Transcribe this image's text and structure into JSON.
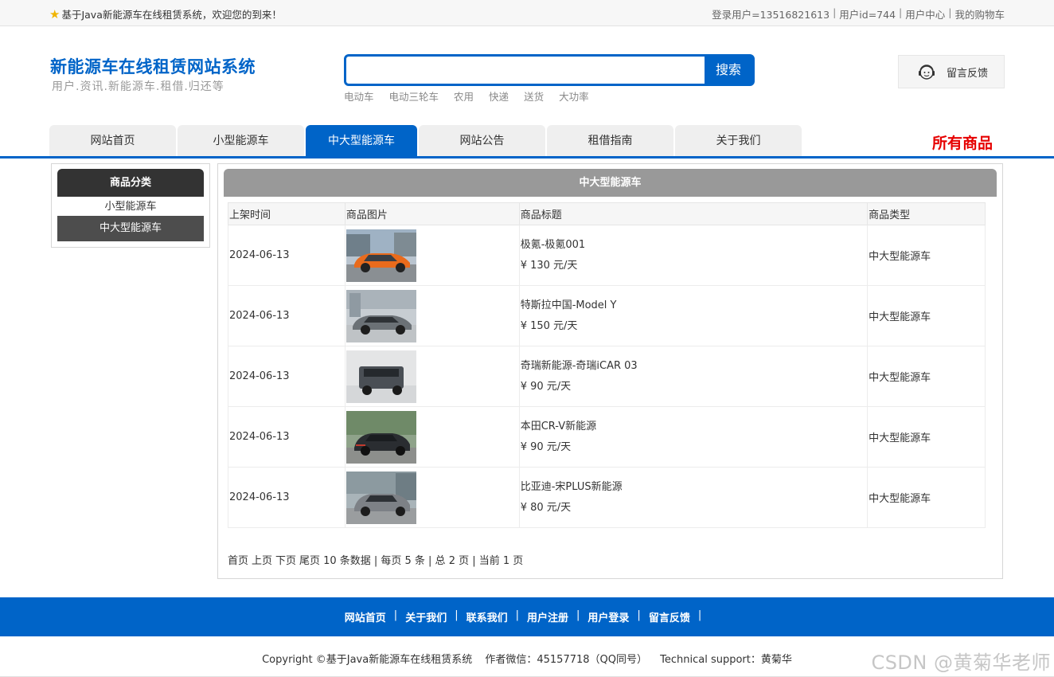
{
  "topbar": {
    "welcome": "基于Java新能源车在线租赁系统，欢迎您的到来！",
    "login_user": "登录用户=13516821613",
    "user_id": "用户id=744",
    "user_center": "用户中心",
    "cart": "我的购物车"
  },
  "header": {
    "site_title": "新能源车在线租赁网站系统",
    "site_subtitle": "用户.资讯.新能源车.租借.归还等",
    "search": {
      "placeholder": "",
      "button": "搜索"
    },
    "hot_keywords": [
      "电动车",
      "电动三轮车",
      "农用",
      "快递",
      "送货",
      "大功率"
    ],
    "feedback": "留言反馈"
  },
  "nav": {
    "tabs": [
      {
        "label": "网站首页",
        "active": false
      },
      {
        "label": "小型能源车",
        "active": false
      },
      {
        "label": "中大型能源车",
        "active": true
      },
      {
        "label": "网站公告",
        "active": false
      },
      {
        "label": "租借指南",
        "active": false
      },
      {
        "label": "关于我们",
        "active": false
      }
    ],
    "all_goods": "所有商品"
  },
  "sidebar": {
    "title": "商品分类",
    "items": [
      {
        "label": "小型能源车",
        "active": false
      },
      {
        "label": "中大型能源车",
        "active": true
      }
    ]
  },
  "main": {
    "title": "中大型能源车",
    "columns": [
      "上架时间",
      "商品图片",
      "商品标题",
      "商品类型"
    ],
    "rows": [
      {
        "date": "2024-06-13",
        "title": "极氪-极氪001",
        "price": "¥ 130 元/天",
        "type": "中大型能源车",
        "image": "orange-suv"
      },
      {
        "date": "2024-06-13",
        "title": "特斯拉中国-Model Y",
        "price": "¥ 150 元/天",
        "type": "中大型能源车",
        "image": "gray-suv"
      },
      {
        "date": "2024-06-13",
        "title": "奇瑞新能源-奇瑞iCAR 03",
        "price": "¥ 90 元/天",
        "type": "中大型能源车",
        "image": "dark-boxy-suv"
      },
      {
        "date": "2024-06-13",
        "title": "本田CR-V新能源",
        "price": "¥ 90 元/天",
        "type": "中大型能源车",
        "image": "black-suv"
      },
      {
        "date": "2024-06-13",
        "title": "比亚迪-宋PLUS新能源",
        "price": "¥ 80 元/天",
        "type": "中大型能源车",
        "image": "silver-suv"
      }
    ],
    "pager": {
      "first": "首页",
      "prev": "上页",
      "next": "下页",
      "last": "尾页",
      "summary": "10 条数据 | 每页 5 条 | 总 2 页 | 当前 1 页"
    }
  },
  "footer": {
    "links": [
      "网站首页",
      "关于我们",
      "联系我们",
      "用户注册",
      "用户登录",
      "留言反馈"
    ],
    "copyright": "Copyright ©基于Java新能源车在线租赁系统",
    "author": "作者微信：45157718（QQ同号）",
    "support": "Technical support：黄菊华"
  },
  "watermark": "CSDN @黄菊华老师",
  "colors": {
    "brand_blue": "#0064c8",
    "accent_red": "#e60000",
    "header_gray": "#999999",
    "dark": "#333333"
  }
}
